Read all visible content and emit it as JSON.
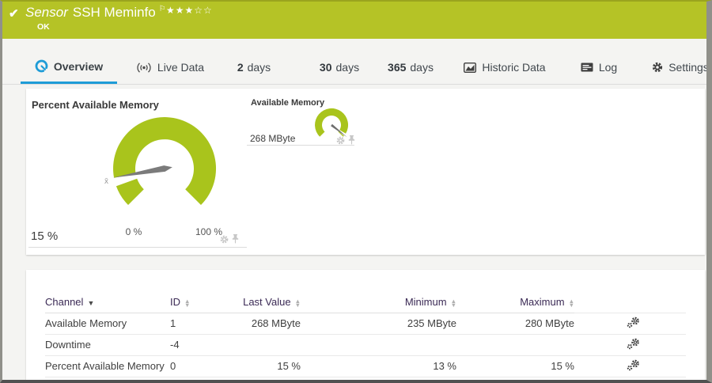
{
  "titlebar": {
    "check_icon": "✔",
    "kind": "Sensor",
    "name": "SSH Meminfo",
    "flag_icon": "⚐",
    "stars": "★★★☆☆",
    "status": "OK"
  },
  "tabs": [
    {
      "label": "Overview",
      "active": true
    },
    {
      "label": "Live Data"
    },
    {
      "num": "2",
      "label": "days"
    },
    {
      "num": "30",
      "label": "days"
    },
    {
      "num": "365",
      "label": "days"
    },
    {
      "label": "Historic Data"
    },
    {
      "label": "Log"
    },
    {
      "label": "Settings"
    }
  ],
  "gauges": {
    "primary": {
      "title": "Percent Available Memory",
      "value": 15,
      "unit": "%",
      "value_label": "15 %",
      "scale_min_label": "0 %",
      "scale_max_label": "100 %",
      "avg_marker": "x̄",
      "gauge_color": "#a9c41c",
      "needle_color": "#7b7b7b"
    },
    "secondary": {
      "title": "Available Memory",
      "value": 268,
      "unit": "MByte",
      "value_label": "268 MByte",
      "gauge_color": "#a9c41c",
      "needle_color": "#6e6e6e"
    }
  },
  "channel_table": {
    "columns": [
      {
        "label": "Channel",
        "sort": "desc"
      },
      {
        "label": "ID",
        "sort": "both"
      },
      {
        "label": "Last Value",
        "sort": "both"
      },
      {
        "label": "Minimum",
        "sort": "both"
      },
      {
        "label": "Maximum",
        "sort": "both"
      }
    ],
    "rows": [
      {
        "channel": "Available Memory",
        "id": "1",
        "last_value": "268 MByte",
        "minimum": "235 MByte",
        "maximum": "280 MByte"
      },
      {
        "channel": "Downtime",
        "id": "-4",
        "last_value": "",
        "minimum": "",
        "maximum": ""
      },
      {
        "channel": "Percent Available Memory",
        "id": "0",
        "last_value": "15 %",
        "minimum": "13 %",
        "maximum": "15 %"
      }
    ]
  },
  "colors": {
    "status_green": "#b5c326",
    "accent_blue": "#1e9cd7",
    "header_purple": "#3b2a55",
    "gauge_green": "#a9c41c"
  }
}
